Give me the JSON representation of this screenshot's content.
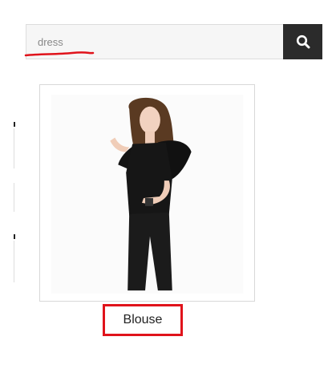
{
  "search": {
    "value": "dress",
    "button_icon": "search-icon"
  },
  "product": {
    "name": "Blouse",
    "image_icon": "product-photo-woman-black-blouse"
  },
  "colors": {
    "search_button_bg": "#2b2b2b",
    "highlight_red": "#e0131b",
    "card_border": "#d8d8d8"
  }
}
